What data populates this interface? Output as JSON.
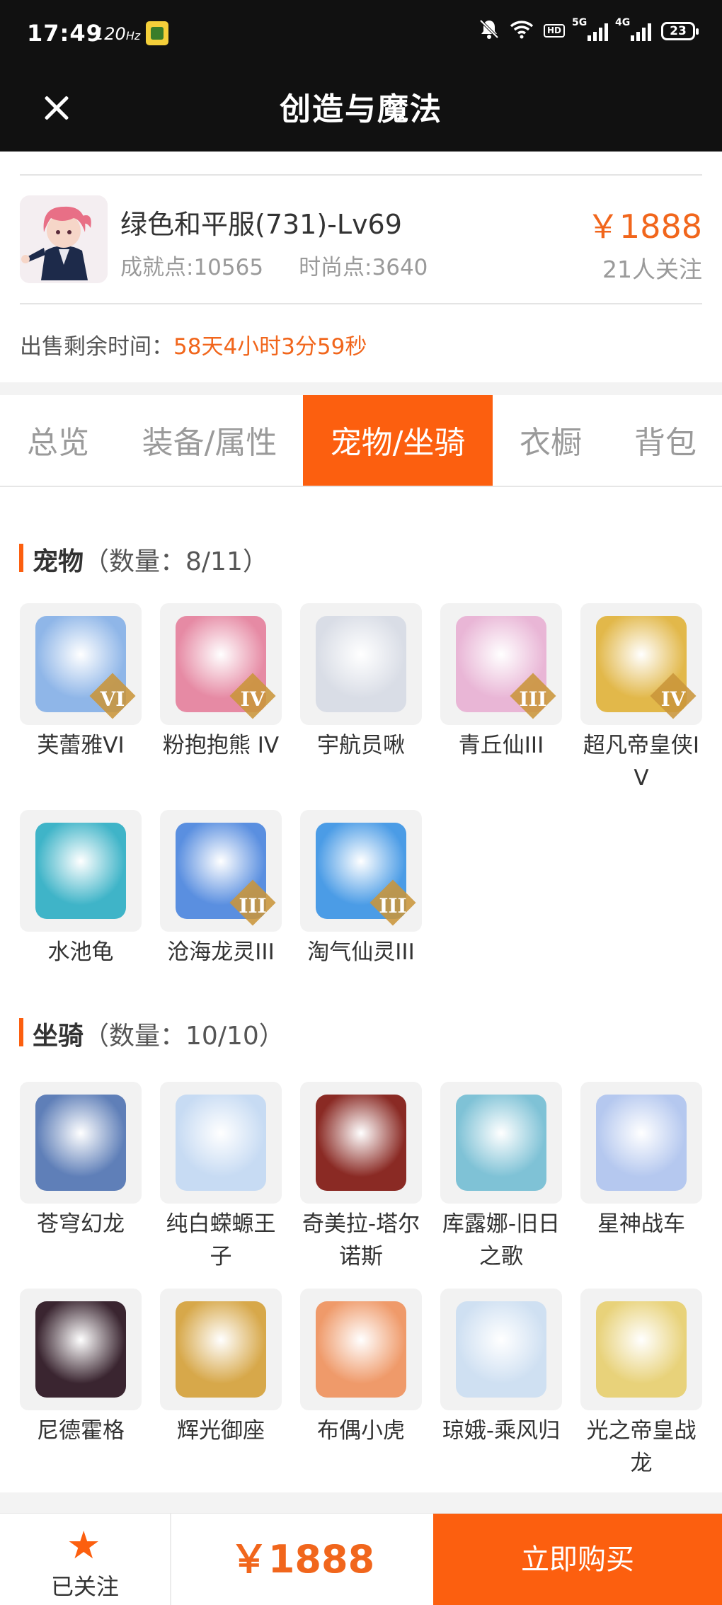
{
  "status_bar": {
    "time": "17:49",
    "refresh_rate": "120",
    "refresh_unit": "Hz",
    "hd_label": "HD",
    "net_5g": "5G",
    "net_4g": "4G",
    "battery": "23"
  },
  "header": {
    "title": "创造与魔法"
  },
  "character": {
    "name": "绿色和平服(731)-Lv69",
    "achievement": "成就点:10565",
    "fashion": "时尚点:3640",
    "price": "￥1888",
    "followers": "21人关注",
    "remaining_label": "出售剩余时间：",
    "remaining_value": "58天4小时3分59秒"
  },
  "tabs": [
    "总览",
    "装备/属性",
    "宠物/坐骑",
    "衣橱",
    "背包"
  ],
  "pets": {
    "title": "宠物",
    "count": "（数量：8/11）",
    "items": [
      {
        "name": "芙蕾雅VI",
        "badge": "VI",
        "color": "#8fb6e8"
      },
      {
        "name": "粉抱抱熊 IV",
        "badge": "IV",
        "color": "#e68aa4"
      },
      {
        "name": "宇航员啾",
        "badge": "",
        "color": "#d9dde6"
      },
      {
        "name": "青丘仙III",
        "badge": "III",
        "color": "#e9b6d6"
      },
      {
        "name": "超凡帝皇侠IV",
        "badge": "IV",
        "color": "#e2b84a"
      },
      {
        "name": "水池龟",
        "badge": "",
        "color": "#3fb4c8"
      },
      {
        "name": "沧海龙灵III",
        "badge": "III",
        "color": "#5a8fe0"
      },
      {
        "name": "淘气仙灵III",
        "badge": "III",
        "color": "#4b9ce6"
      }
    ]
  },
  "mounts": {
    "title": "坐骑",
    "count": "（数量：10/10）",
    "items": [
      {
        "name": "苍穹幻龙",
        "color": "#5f7fb8"
      },
      {
        "name": "纯白蝾螈王子",
        "color": "#c7dbf3"
      },
      {
        "name": "奇美拉-塔尔诺斯",
        "color": "#8a2a24"
      },
      {
        "name": "库露娜-旧日之歌",
        "color": "#7fc2d6"
      },
      {
        "name": "星神战车",
        "color": "#b5c8ef"
      },
      {
        "name": "尼德霍格",
        "color": "#3a2530"
      },
      {
        "name": "辉光御座",
        "color": "#d7a84a"
      },
      {
        "name": "布偶小虎",
        "color": "#ef9a6a"
      },
      {
        "name": "琼娥-乘风归",
        "color": "#cfe0f2"
      },
      {
        "name": "光之帝皇战龙",
        "color": "#e8d27a"
      }
    ]
  },
  "bottom": {
    "follow_label": "已关注",
    "price": "￥1888",
    "buy_label": "立即购买"
  },
  "colors": {
    "accent": "#fc5f0f",
    "price": "#f1661c"
  }
}
